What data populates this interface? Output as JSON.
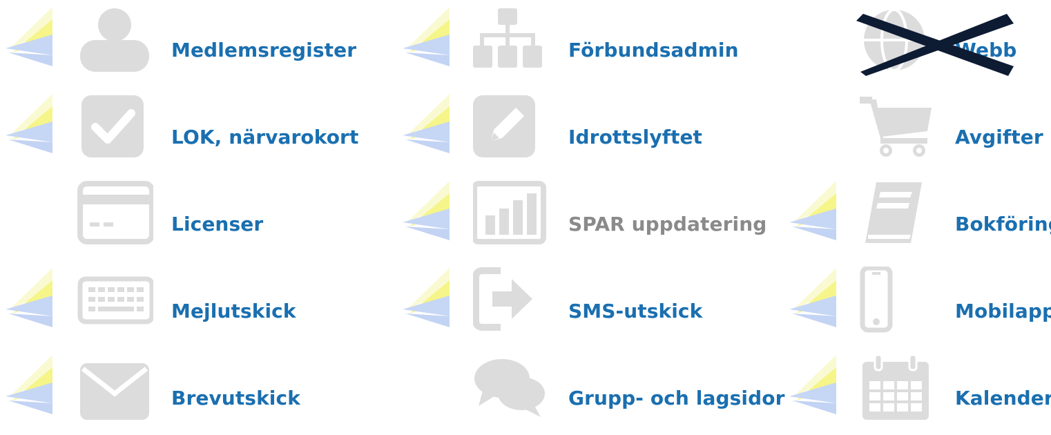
{
  "colors": {
    "link": "#1a6fb0",
    "disabled": "#8a8a8a",
    "icon_gray": "#dcdcdc",
    "cross": "#0d1b33"
  },
  "columns": [
    {
      "items": [
        {
          "label": "Medlemsregister",
          "icon": "user-icon",
          "decor": true
        },
        {
          "label": "LOK, närvarokort",
          "icon": "checkbox-icon",
          "decor": true
        },
        {
          "label": "Licenser",
          "icon": "credit-card-icon",
          "decor": false
        },
        {
          "label": "Mejlutskick",
          "icon": "keyboard-icon",
          "decor": true
        },
        {
          "label": "Brevutskick",
          "icon": "envelope-icon",
          "decor": true
        }
      ]
    },
    {
      "items": [
        {
          "label": "Förbundsadmin",
          "icon": "sitemap-icon",
          "decor": true
        },
        {
          "label": "Idrottslyftet",
          "icon": "pencil-square-icon",
          "decor": true
        },
        {
          "label": "SPAR uppdatering",
          "icon": "bar-chart-icon",
          "decor": true,
          "disabled": true
        },
        {
          "label": "SMS-utskick",
          "icon": "share-arrow-icon",
          "decor": true
        },
        {
          "label": "Grupp- och lagsidor",
          "icon": "chat-bubbles-icon",
          "decor": false
        }
      ]
    },
    {
      "items": [
        {
          "label": "Webb",
          "icon": "globe-icon",
          "decor": false,
          "crossed_out": true
        },
        {
          "label": "Avgifter",
          "icon": "shopping-cart-icon",
          "decor": false
        },
        {
          "label": "Bokföring",
          "icon": "book-icon",
          "decor": true
        },
        {
          "label": "Mobilapp",
          "icon": "mobile-phone-icon",
          "decor": true
        },
        {
          "label": "Kalender",
          "icon": "calendar-icon",
          "decor": true
        }
      ]
    }
  ]
}
